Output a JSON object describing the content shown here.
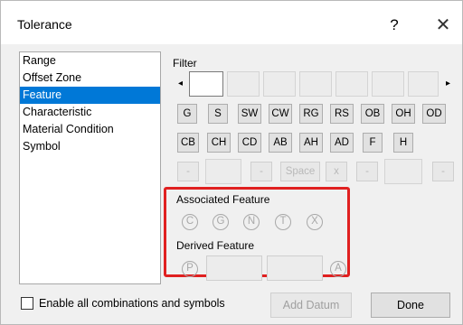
{
  "window": {
    "title": "Tolerance",
    "help_label": "?",
    "close_label": "✕"
  },
  "categories": [
    {
      "label": "Range"
    },
    {
      "label": "Offset Zone"
    },
    {
      "label": "Feature"
    },
    {
      "label": "Characteristic"
    },
    {
      "label": "Material Condition"
    },
    {
      "label": "Symbol"
    }
  ],
  "selected_category": "Feature",
  "filter": {
    "label": "Filter",
    "left_arrow": "◂",
    "right_arrow": "▸"
  },
  "buttons_row1": [
    "G",
    "S",
    "SW",
    "CW",
    "RG",
    "RS",
    "OB",
    "OH",
    "OD"
  ],
  "buttons_row2": [
    "CB",
    "CH",
    "CD",
    "AB",
    "AH",
    "AD",
    "F",
    "H"
  ],
  "row3": {
    "minus": "-",
    "space": "Space",
    "x": "x"
  },
  "associated": {
    "label": "Associated Feature",
    "symbols": [
      "C",
      "G",
      "N",
      "T",
      "X"
    ]
  },
  "derived": {
    "label": "Derived Feature",
    "p": "P",
    "a": "A"
  },
  "footer": {
    "checkbox_label": "Enable all combinations and symbols",
    "add_datum": "Add Datum",
    "done": "Done"
  },
  "colors": {
    "selection": "#0078d7",
    "highlight_box": "#e02020"
  }
}
